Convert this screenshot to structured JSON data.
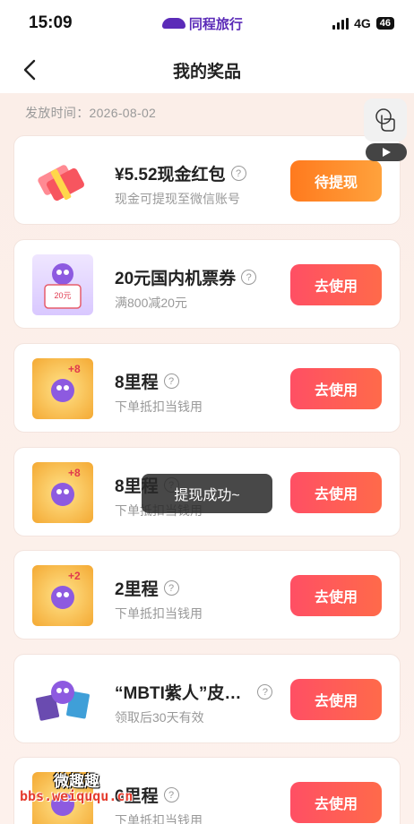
{
  "status_bar": {
    "time": "15:09",
    "carrier_app": "同程旅行",
    "network": "4G",
    "battery": "46"
  },
  "nav": {
    "title": "我的奖品"
  },
  "issue_date": "发放时间：2026-08-02",
  "prizes": [
    {
      "title": "¥5.52现金红包",
      "subtitle": "现金可提现至微信账号",
      "action": "待提现",
      "thumb_text": ""
    },
    {
      "title": "20元国内机票券",
      "subtitle": "满800减20元",
      "action": "去使用",
      "thumb_text": "20元"
    },
    {
      "title": "8里程",
      "subtitle": "下单抵扣当钱用",
      "action": "去使用",
      "thumb_text": "+8"
    },
    {
      "title": "8里程",
      "subtitle": "下单抵扣当钱用",
      "action": "去使用",
      "thumb_text": "+8"
    },
    {
      "title": "2里程",
      "subtitle": "下单抵扣当钱用",
      "action": "去使用",
      "thumb_text": "+2"
    },
    {
      "title": "“MBTI紫人”皮…",
      "subtitle": "领取后30天有效",
      "action": "去使用",
      "thumb_text": ""
    },
    {
      "title": "6里程",
      "subtitle": "下单抵扣当钱用",
      "action": "去使用",
      "thumb_text": ""
    }
  ],
  "toast": "提现成功~",
  "watermark": {
    "top": "微趣趣",
    "bottom": "bbs.weiququ.cn"
  },
  "colors": {
    "accent_red": "#ff4f64",
    "accent_orange": "#ff8a28",
    "brand_purple": "#5b2bb8"
  }
}
